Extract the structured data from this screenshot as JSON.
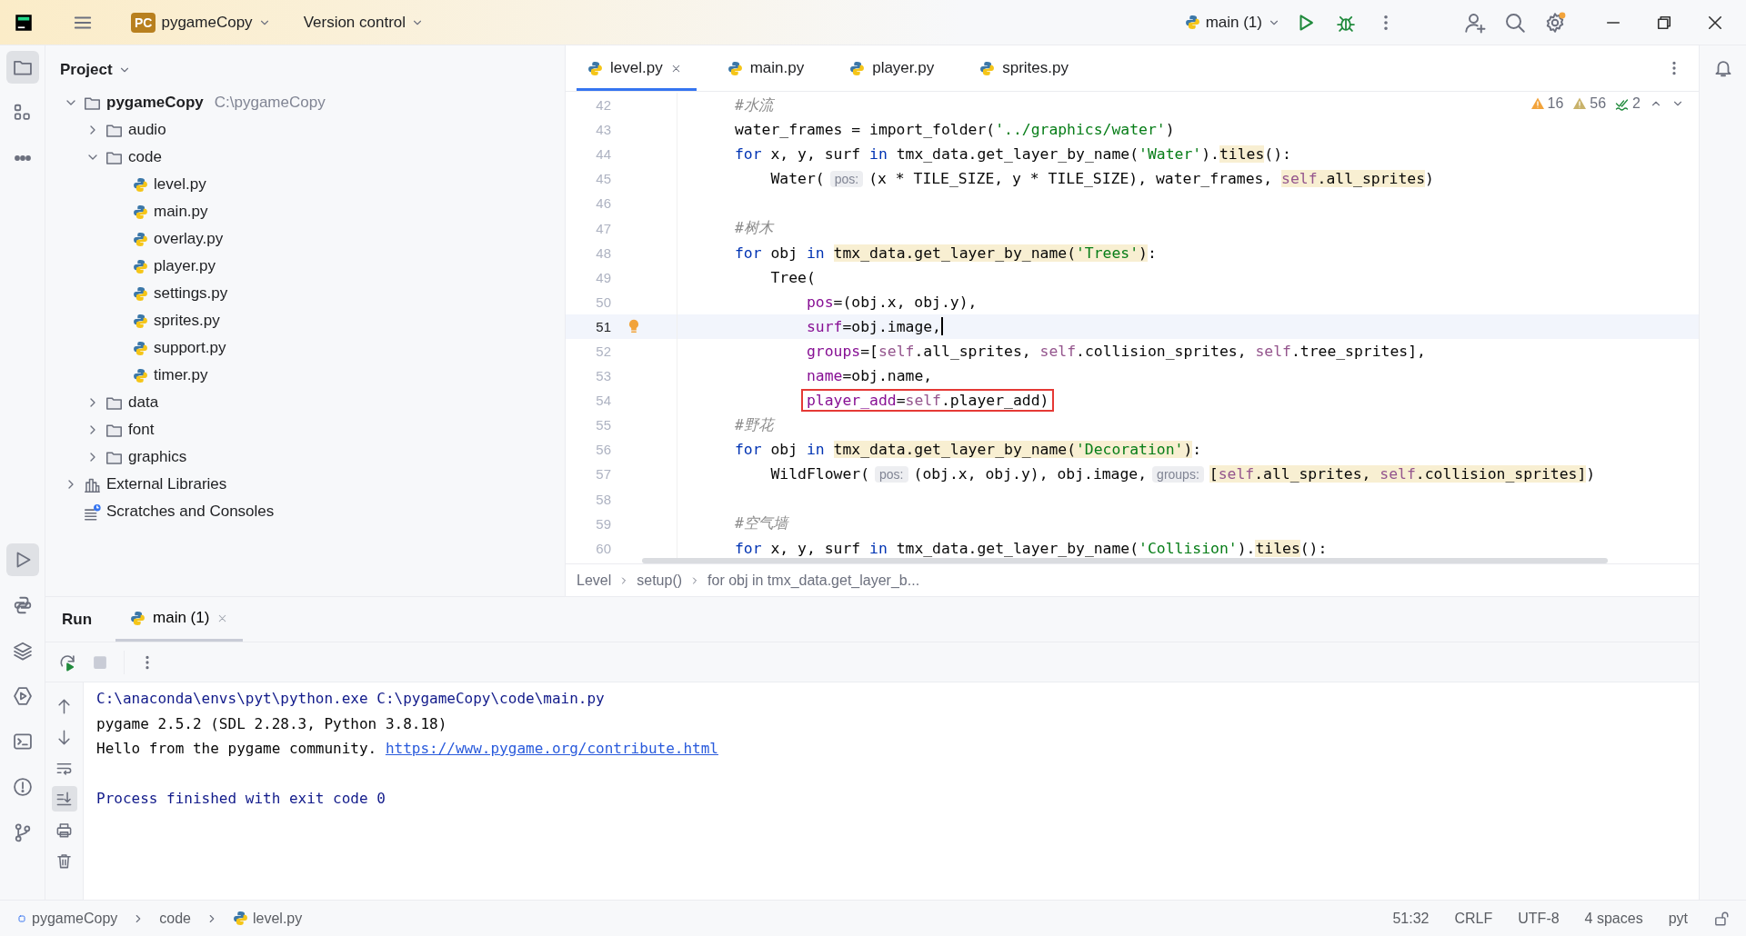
{
  "title_bar": {
    "project_badge": "PC",
    "project": "pygameCopy",
    "vcs": "Version control",
    "run_config": "main (1)"
  },
  "tool_windows": [
    {
      "kind": "project",
      "selected": true
    },
    {
      "kind": "structure",
      "selected": false
    },
    {
      "kind": "more",
      "selected": false
    },
    {
      "kind": "run",
      "selected": true
    },
    {
      "kind": "python-console",
      "selected": false
    },
    {
      "kind": "layers",
      "selected": false
    },
    {
      "kind": "services",
      "selected": false
    },
    {
      "kind": "terminal",
      "selected": false
    },
    {
      "kind": "problems",
      "selected": false
    },
    {
      "kind": "git",
      "selected": false
    }
  ],
  "project_panel": {
    "title": "Project",
    "tree": [
      {
        "label": "pygameCopy",
        "path": "C:\\pygameCopy",
        "kind": "folder",
        "expanded": true,
        "children": [
          {
            "label": "audio",
            "kind": "folder",
            "expanded": false
          },
          {
            "label": "code",
            "kind": "folder",
            "expanded": true,
            "children": [
              {
                "label": "level.py",
                "kind": "python"
              },
              {
                "label": "main.py",
                "kind": "python"
              },
              {
                "label": "overlay.py",
                "kind": "python"
              },
              {
                "label": "player.py",
                "kind": "python"
              },
              {
                "label": "settings.py",
                "kind": "python"
              },
              {
                "label": "sprites.py",
                "kind": "python"
              },
              {
                "label": "support.py",
                "kind": "python"
              },
              {
                "label": "timer.py",
                "kind": "python"
              }
            ]
          },
          {
            "label": "data",
            "kind": "folder",
            "expanded": false
          },
          {
            "label": "font",
            "kind": "folder",
            "expanded": false
          },
          {
            "label": "graphics",
            "kind": "folder",
            "expanded": false
          }
        ]
      },
      {
        "label": "External Libraries",
        "kind": "library",
        "expanded": false
      },
      {
        "label": "Scratches and Consoles",
        "kind": "scratches"
      }
    ]
  },
  "editor": {
    "tabs": [
      {
        "label": "level.py",
        "selected": true
      },
      {
        "label": "main.py",
        "selected": false
      },
      {
        "label": "player.py",
        "selected": false
      },
      {
        "label": "sprites.py",
        "selected": false
      }
    ],
    "inspections": [
      {
        "kind": "warning",
        "count": "16"
      },
      {
        "kind": "weak-warning",
        "count": "56"
      },
      {
        "kind": "typo",
        "count": "2"
      }
    ],
    "lines": [
      {
        "number": "42",
        "current": false,
        "segments": [
          {
            "text": "#水流",
            "kind": "comment"
          }
        ]
      },
      {
        "number": "43",
        "current": false,
        "segments": [
          {
            "text": "water_frames = import_folder(",
            "kind": "plain"
          },
          {
            "text": "'../graphics/water'",
            "kind": "string"
          },
          {
            "text": ")",
            "kind": "plain"
          }
        ]
      },
      {
        "number": "44",
        "current": false,
        "segments": [
          {
            "text": "for",
            "kind": "keyword"
          },
          {
            "text": " x, y, surf ",
            "kind": "plain"
          },
          {
            "text": "in",
            "kind": "keyword"
          },
          {
            "text": " tmx_data.get_layer_by_name(",
            "kind": "plain"
          },
          {
            "text": "'Water'",
            "kind": "string"
          },
          {
            "text": ").",
            "kind": "plain"
          },
          {
            "text": "tiles",
            "kind": "plain",
            "highlighted": true
          },
          {
            "text": "():",
            "kind": "plain"
          }
        ]
      },
      {
        "number": "45",
        "current": false,
        "segments": [
          {
            "text": "    Water(",
            "kind": "plain"
          },
          {
            "text": "pos:",
            "kind": "hint"
          },
          {
            "text": "(x * TILE_SIZE, y * TILE_SIZE), water_frames, ",
            "kind": "plain"
          },
          {
            "text": "self",
            "kind": "self",
            "highlighted": true
          },
          {
            "text": ".all_sprites",
            "kind": "plain",
            "highlighted": true
          },
          {
            "text": ")",
            "kind": "plain"
          }
        ]
      },
      {
        "number": "46",
        "current": false
      },
      {
        "number": "47",
        "current": false,
        "segments": [
          {
            "text": "#树木",
            "kind": "comment"
          }
        ]
      },
      {
        "number": "48",
        "current": false,
        "segments": [
          {
            "text": "for",
            "kind": "keyword"
          },
          {
            "text": " obj ",
            "kind": "plain"
          },
          {
            "text": "in ",
            "kind": "keyword"
          },
          {
            "text": "tmx_data.get_layer_by_name(",
            "kind": "plain",
            "highlighted": true
          },
          {
            "text": "'Trees'",
            "kind": "string",
            "highlighted": true
          },
          {
            "text": ")",
            "kind": "plain",
            "highlighted": true
          },
          {
            "text": ":",
            "kind": "plain"
          }
        ]
      },
      {
        "number": "49",
        "current": false,
        "segments": [
          {
            "text": "    Tree(",
            "kind": "plain"
          }
        ]
      },
      {
        "number": "50",
        "current": false,
        "segments": [
          {
            "text": "        pos",
            "kind": "argument"
          },
          {
            "text": "=(obj.x, obj.y),",
            "kind": "plain"
          }
        ]
      },
      {
        "number": "51",
        "current": true,
        "bulb": true,
        "segments": [
          {
            "text": "        surf",
            "kind": "argument"
          },
          {
            "text": "=obj.image,",
            "kind": "plain"
          }
        ]
      },
      {
        "number": "52",
        "current": false,
        "segments": [
          {
            "text": "        groups",
            "kind": "argument"
          },
          {
            "text": "=[",
            "kind": "plain"
          },
          {
            "text": "self",
            "kind": "self"
          },
          {
            "text": ".all_sprites, ",
            "kind": "plain"
          },
          {
            "text": "self",
            "kind": "self"
          },
          {
            "text": ".collision_sprites, ",
            "kind": "plain"
          },
          {
            "text": "self",
            "kind": "self"
          },
          {
            "text": ".tree_sprites],",
            "kind": "plain"
          }
        ]
      },
      {
        "number": "53",
        "current": false,
        "segments": [
          {
            "text": "        name",
            "kind": "argument"
          },
          {
            "text": "=obj.name,",
            "kind": "plain"
          }
        ]
      },
      {
        "number": "54",
        "current": false,
        "boxed": true,
        "segments": [
          {
            "text": "        player_add",
            "kind": "argument"
          },
          {
            "text": "=",
            "kind": "plain"
          },
          {
            "text": "self",
            "kind": "self"
          },
          {
            "text": ".player_add)",
            "kind": "plain"
          }
        ]
      },
      {
        "number": "55",
        "current": false,
        "segments": [
          {
            "text": "#野花",
            "kind": "comment"
          }
        ]
      },
      {
        "number": "56",
        "current": false,
        "segments": [
          {
            "text": "for",
            "kind": "keyword"
          },
          {
            "text": " obj ",
            "kind": "plain"
          },
          {
            "text": "in ",
            "kind": "keyword"
          },
          {
            "text": "tmx_data.get_layer_by_name(",
            "kind": "plain",
            "highlighted": true
          },
          {
            "text": "'Decoration'",
            "kind": "string",
            "highlighted": true
          },
          {
            "text": ")",
            "kind": "plain",
            "highlighted": true
          },
          {
            "text": ":",
            "kind": "plain"
          }
        ]
      },
      {
        "number": "57",
        "current": false,
        "segments": [
          {
            "text": "    WildFlower(",
            "kind": "plain"
          },
          {
            "text": "pos:",
            "kind": "hint"
          },
          {
            "text": "(obj.x, obj.y), obj.image,",
            "kind": "plain"
          },
          {
            "text": "groups:",
            "kind": "hint"
          },
          {
            "text": "[",
            "kind": "plain",
            "highlighted": true
          },
          {
            "text": "self",
            "kind": "self",
            "highlighted": true
          },
          {
            "text": ".all_sprites, ",
            "kind": "plain",
            "highlighted": true
          },
          {
            "text": "self",
            "kind": "self",
            "highlighted": true
          },
          {
            "text": ".collision_sprites]",
            "kind": "plain",
            "highlighted": true
          },
          {
            "text": ")",
            "kind": "plain"
          }
        ]
      },
      {
        "number": "58",
        "current": false
      },
      {
        "number": "59",
        "current": false,
        "segments": [
          {
            "text": "#空气墙",
            "kind": "comment"
          }
        ]
      },
      {
        "number": "60",
        "current": false,
        "segments": [
          {
            "text": "for",
            "kind": "keyword"
          },
          {
            "text": " x, y, surf ",
            "kind": "plain"
          },
          {
            "text": "in",
            "kind": "keyword"
          },
          {
            "text": " tmx_data.get_layer_by_name(",
            "kind": "plain"
          },
          {
            "text": "'Collision'",
            "kind": "string"
          },
          {
            "text": ").",
            "kind": "plain"
          },
          {
            "text": "tiles",
            "kind": "plain",
            "highlighted": true
          },
          {
            "text": "():",
            "kind": "plain"
          }
        ]
      }
    ],
    "breadcrumbs": [
      "Level",
      "setup()",
      "for obj in tmx_data.get_layer_b..."
    ]
  },
  "run_panel": {
    "title": "Run",
    "tabs": [
      {
        "label": "main (1)",
        "selected": true
      }
    ],
    "scroll_to_end": true,
    "console": [
      {
        "kind": "system",
        "text": "C:\\anaconda\\envs\\pyt\\python.exe C:\\pygameCopy\\code\\main.py"
      },
      {
        "kind": "output",
        "text": "pygame 2.5.2 (SDL 2.28.3, Python 3.8.18)"
      },
      {
        "kind": "output",
        "text": "Hello from the pygame community. ",
        "link": "https://www.pygame.org/contribute.html"
      },
      {
        "kind": "system",
        "text": "Process finished with exit code 0",
        "gap_before": true
      }
    ]
  },
  "status_bar": {
    "path": [
      {
        "label": "pygameCopy",
        "kind": "module"
      },
      {
        "label": "code",
        "kind": "dir"
      },
      {
        "label": "level.py",
        "kind": "python"
      }
    ],
    "items": [
      "51:32",
      "CRLF",
      "UTF-8",
      "4 spaces",
      "pyt"
    ]
  }
}
